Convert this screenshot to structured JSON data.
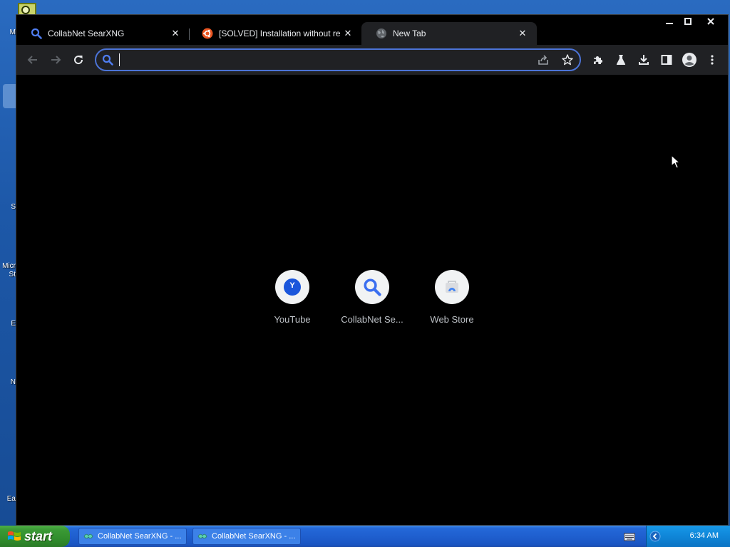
{
  "desktop": {
    "labels": [
      "M",
      "S",
      "Micr",
      "St",
      "E",
      "N",
      "Ea"
    ]
  },
  "browser": {
    "tabs": [
      {
        "title": "CollabNet SearXNG",
        "icon": "search-icon",
        "active": false
      },
      {
        "title": "[SOLVED] Installation without reboot",
        "icon": "ubuntu-icon",
        "active": false
      },
      {
        "title": "New Tab",
        "icon": "globe-icon",
        "active": true
      }
    ],
    "omnibox": {
      "value": "",
      "placeholder": ""
    },
    "shortcuts": [
      {
        "label": "YouTube",
        "icon": "youtube-letter-icon",
        "letter": "Y"
      },
      {
        "label": "CollabNet Se...",
        "icon": "search-icon"
      },
      {
        "label": "Web Store",
        "icon": "web-store-icon"
      }
    ]
  },
  "taskbar": {
    "start_label": "start",
    "tasks": [
      {
        "label": "CollabNet SearXNG - ..."
      },
      {
        "label": "CollabNet SearXNG - ..."
      }
    ],
    "clock": "6:34 AM"
  },
  "colors": {
    "accent": "#4c74d8",
    "toolbar": "#202124",
    "tab_text": "#e8eaed",
    "taskbar": "#1f5fcf",
    "start": "#3a9a35"
  }
}
